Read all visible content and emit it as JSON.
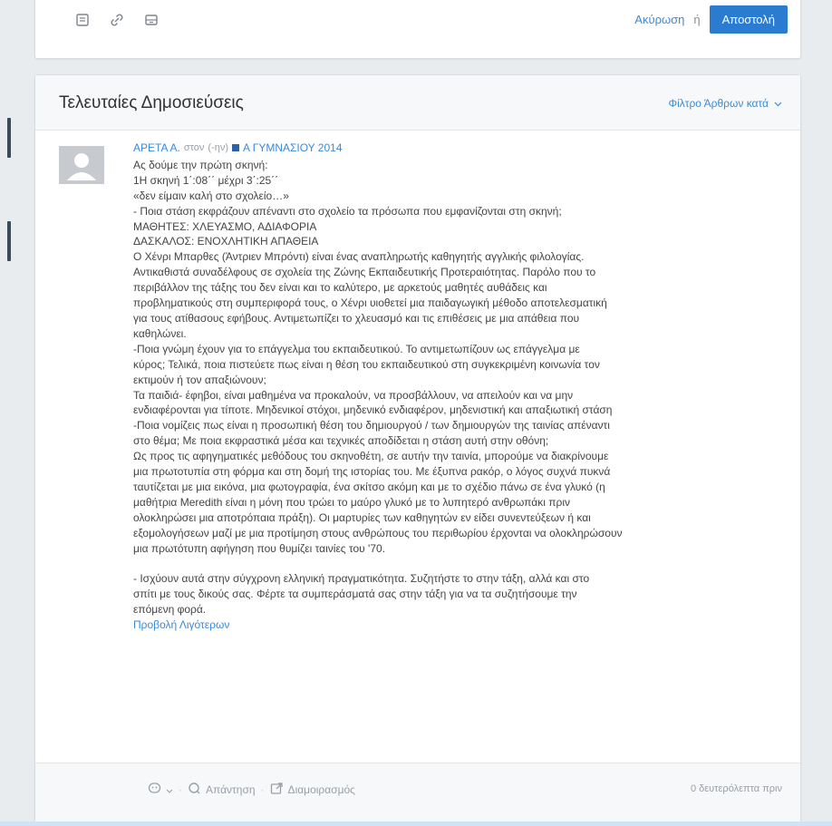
{
  "composer": {
    "cancel_label": "Ακύρωση",
    "or_label": "ή",
    "send_label": "Αποστολή"
  },
  "posts_panel": {
    "title": "Τελευταίες Δημοσιεύσεις",
    "filter_label": "Φίλτρο Άρθρων κατά"
  },
  "post": {
    "author": "ΑΡΕΤΑ Α.",
    "context_word": "στον",
    "context_extra": "(-ην)",
    "group": "Α ΓΥΜΝΑΣΙΟΥ 2014",
    "lines": [
      "Ας δούμε την πρώτη σκηνή:",
      "1Η σκηνή 1΄:08΄΄ μέχρι 3΄:25΄΄",
      "«δεν είμαιν καλή στο σχολείο…»",
      "- Ποια στάση εκφράζουν απέναντι στο σχολείο τα πρόσωπα που εμφανίζονται στη σκηνή;",
      "ΜΑΘΗΤΕΣ: ΧΛΕΥΑΣΜΟ, ΑΔΙΑΦΟΡΙΑ",
      "ΔΑΣΚΑΛΟΣ: ΕΝΟΧΛΗΤΙΚΗ ΑΠΑΘΕΙΑ",
      "Ο Χένρι Μπαρθες (Άντριεν Μπρόντι) είναι ένας αναπληρωτής καθηγητής αγγλικής φιλολογίας.",
      "Αντικαθιστά συναδέλφους σε σχολεία της Ζώνης Εκπαιδευτικής Προτεραιότητας. Παρόλο που το",
      "περιβάλλον της τάξης του δεν είναι και το καλύτερο, με αρκετούς μαθητές αυθάδεις και",
      "προβληματικούς στη συμπεριφορά τους, ο Χένρι υιοθετεί μια παιδαγωγική μέθοδο αποτελεσματική",
      "για τους ατίθασους εφήβους. Αντιμετωπίζει το χλευασμό και τις επιθέσεις με μια απάθεια που",
      "καθηλώνει.",
      "-Ποια γνώμη έχουν για το επάγγελμα του εκπαιδευτικού. Το αντιμετωπίζουν ως επάγγελμα με",
      "κύρος; Τελικά, ποια πιστεύετε πως είναι η θέση του εκπαιδευτικού στη συγκεκριμένη κοινωνία τον",
      "εκτιμούν ή τον απαξιώνουν;",
      "Τα παιδιά- έφηβοι, είναι μαθημένα να προκαλούν, να προσβάλλουν, να απειλούν και να μην",
      "ενδιαφέρονται για τίποτε. Μηδενικοί στόχοι, μηδενικό ενδιαφέρον, μηδενιστική και απαξιωτική στάση",
      "-Ποια νομίζεις πως είναι η προσωπική θέση του δημιουργού / των δημιουργών της ταινίας απέναντι",
      "στο θέμα; Με ποια εκφραστικά μέσα και τεχνικές αποδίδεται η στάση αυτή στην οθόνη;",
      "Ως προς τις αφηγηματικές μεθόδους του σκηνοθέτη, σε αυτήν την ταινία, μπορούμε να διακρίνουμε",
      "μια πρωτοτυπία στη φόρμα και στη δομή της ιστορίας του. Με έξυπνα ρακόρ, ο λόγος συχνά πυκνά",
      "ταυτίζεται με μια εικόνα, μια φωτογραφία, ένα σκίτσο ακόμη και με το σχέδιο πάνω σε ένα γλυκό (η",
      "μαθήτρια Meredith είναι η μόνη που τρώει το μαύρο γλυκό με το λυπητερό ανθρωπάκι πριν",
      "ολοκληρώσει μια αποτρόπαια πράξη). Οι μαρτυρίες των καθηγητών εν είδει συνεντεύξεων ή και",
      "εξομολογήσεων μαζί με μια προτίμηση στους ανθρώπους του περιθωρίου έρχονται να ολοκληρώσουν",
      "μια πρωτότυπη αφήγηση που θυμίζει ταινίες του '70.",
      "",
      "- Ισχύουν αυτά στην σύγχρονη ελληνική πραγματικότητα. Συζητήστε το στην τάξη, αλλά και στο",
      "σπίτι με τους δικούς σας. Φέρτε τα συμπεράσματά σας στην τάξη για να τα συζητήσουμε την",
      "επόμενη φορά."
    ],
    "read_less": "Προβολή Λιγότερων"
  },
  "footer": {
    "reply_label": "Απάντηση",
    "share_label": "Διαμοιρασμός",
    "timestamp": "0 δευτερόλεπτα πριν"
  },
  "icons": {
    "composer_tools": [
      "note-icon",
      "link-icon",
      "attachment-icon"
    ],
    "footer": [
      "emoji-icon",
      "reply-icon",
      "share-icon"
    ]
  },
  "colors": {
    "accent": "#2b7cd0",
    "link": "#3a8ad6",
    "group_square": "#2b63a8"
  }
}
